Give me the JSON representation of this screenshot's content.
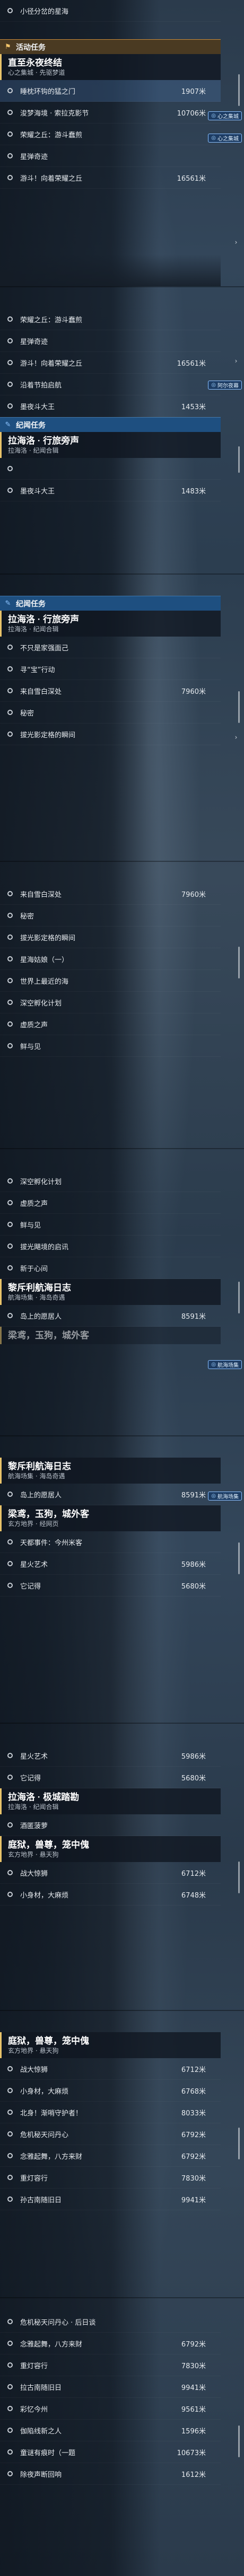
{
  "frames": [
    {
      "items_top": [
        {
          "label": "小径分岔的星海",
          "distance": ""
        }
      ],
      "section": {
        "label": "活动任务",
        "type": "orange"
      },
      "quest": {
        "title": "直至永夜终结",
        "subtitle": "心之集城 · 先驱梦道"
      },
      "items": [
        {
          "label": "睡枕环钩的猛之门",
          "distance": "1907米",
          "badge": "心之集城"
        },
        {
          "label": "浚梦海境 · 索拉克影节",
          "distance": "10706米",
          "badge": "心之集城"
        },
        {
          "label": "荣耀之丘：游斗蠢煎",
          "distance": ""
        },
        {
          "label": "星弹奇迹",
          "distance": ""
        },
        {
          "label": "游斗！向着荣耀之丘",
          "distance": "16561米"
        }
      ]
    },
    {
      "items": [
        {
          "label": "荣耀之丘：游斗蠢煎",
          "distance": ""
        },
        {
          "label": "星弹奇迹",
          "distance": ""
        },
        {
          "label": "游斗！向着荣耀之丘",
          "distance": "16561米"
        },
        {
          "label": "沿着节拍启航",
          "distance": ""
        },
        {
          "label": "墨夜斗大王",
          "distance": "1453米",
          "badge": "阿尔夜幕"
        }
      ],
      "section": {
        "label": "纪闻任务",
        "type": "blue"
      },
      "quest": {
        "title": "拉海洛 · 行旅旁声",
        "subtitle": "拉海洛 · 纪闻合辑"
      },
      "items_after": [
        {
          "label": "",
          "distance": ""
        },
        {
          "label": "墨夜斗大王",
          "distance": "1483米"
        }
      ]
    },
    {
      "section": {
        "label": "纪闻任务",
        "type": "blue"
      },
      "quest": {
        "title": "拉海洛 · 行旅旁声",
        "subtitle": "拉海洛 · 纪闻合辑"
      },
      "items": [
        {
          "label": "不只是家强面己",
          "distance": ""
        },
        {
          "label": "寻“宝”行动",
          "distance": ""
        },
        {
          "label": "来自雪白深处",
          "distance": "7960米"
        },
        {
          "label": "秘密",
          "distance": ""
        },
        {
          "label": "拔光影定格的瞬间",
          "distance": ""
        }
      ]
    },
    {
      "items": [
        {
          "label": "来自雪白深处",
          "distance": "7960米"
        },
        {
          "label": "秘密",
          "distance": ""
        },
        {
          "label": "拔光影定格的瞬间",
          "distance": ""
        },
        {
          "label": "星海姑娘（一）",
          "distance": ""
        },
        {
          "label": "世界上最近的海",
          "distance": ""
        },
        {
          "label": "深空孵化计划",
          "distance": ""
        },
        {
          "label": "虚质之声",
          "distance": ""
        },
        {
          "label": "鲜与见",
          "distance": ""
        }
      ]
    },
    {
      "items": [
        {
          "label": "深空孵化计划",
          "distance": ""
        },
        {
          "label": "虚质之声",
          "distance": ""
        },
        {
          "label": "鲜与见",
          "distance": ""
        },
        {
          "label": "拔光飓境的启讯",
          "distance": ""
        },
        {
          "label": "新于心间",
          "distance": ""
        }
      ],
      "quest": {
        "title": "黎斥利航海日志",
        "subtitle": "航海场集 · 海岛奇遇"
      },
      "items_after": [
        {
          "label": "岛上的愿居人",
          "distance": "8591米",
          "badge": "航海场集"
        }
      ],
      "quest_peek": {
        "title": "梁鸢，玉狗，城外客"
      }
    },
    {
      "quest": {
        "title": "黎斥利航海日志",
        "subtitle": "航海场集 · 海岛奇遇"
      },
      "items": [
        {
          "label": "岛上的愿居人",
          "distance": "8591米",
          "badge": "航海场集"
        }
      ],
      "quest2": {
        "title": "梁鸢，玉狗，城外客",
        "subtitle": "玄方地界 · 经网页"
      },
      "items2": [
        {
          "label": "天都事件：今州米客",
          "distance": ""
        },
        {
          "label": "星火艺术",
          "distance": "5986米"
        },
        {
          "label": "它记得",
          "distance": "5680米"
        }
      ]
    },
    {
      "items": [
        {
          "label": "星火艺术",
          "distance": "5986米"
        },
        {
          "label": "它记得",
          "distance": "5680米"
        }
      ],
      "quest": {
        "title": "拉海洛 · 极城踏勘",
        "subtitle": "拉海洛 · 纪闻合辑"
      },
      "items_after": [
        {
          "label": "酒匿菠萝",
          "distance": ""
        }
      ],
      "quest2": {
        "title": "庭狱，兽尊，笼中傀",
        "subtitle": "玄方地界 · 悬天狗"
      },
      "items2": [
        {
          "label": "战大惊狮",
          "distance": "6712米"
        },
        {
          "label": "小身材，大麻烦",
          "distance": "6748米"
        }
      ]
    },
    {
      "quest": {
        "title": "庭狱，兽尊，笼中傀",
        "subtitle": "玄方地界 · 悬天狗"
      },
      "items": [
        {
          "label": "战大惊狮",
          "distance": "6712米"
        },
        {
          "label": "小身材，大麻烦",
          "distance": "6768米"
        },
        {
          "label": "北身！渐哨守护者！",
          "distance": "8033米"
        },
        {
          "label": "危机秘天问丹心",
          "distance": "6792米"
        },
        {
          "label": "念雅起舞，八方来财",
          "distance": "6792米"
        },
        {
          "label": "重灯容行",
          "distance": "7830米"
        },
        {
          "label": "孙古南随旧日",
          "distance": "9941米"
        }
      ]
    },
    {
      "items": [
        {
          "label": "危机秘天问丹心 · 后日谈",
          "distance": ""
        },
        {
          "label": "念雅起舞，八方来财",
          "distance": "6792米"
        },
        {
          "label": "重灯容行",
          "distance": "7830米"
        },
        {
          "label": "拉古南随旧日",
          "distance": "9941米"
        },
        {
          "label": "彩忆今州",
          "distance": "9561米"
        },
        {
          "label": "伽陷线新之人",
          "distance": "1596米"
        },
        {
          "label": "童谜有痕时（一题",
          "distance": "10673米"
        },
        {
          "label": "除夜声断回响",
          "distance": "1612米"
        }
      ]
    }
  ]
}
